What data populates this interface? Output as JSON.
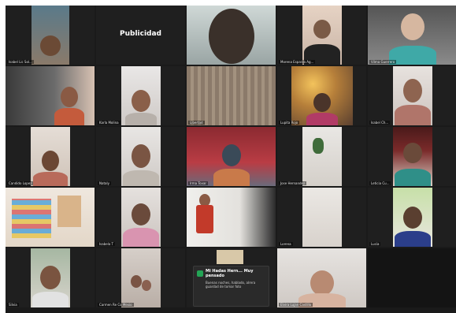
{
  "meeting": {
    "publicidad_label": "Publicidad",
    "notification": {
      "title": "Mi Hadas Hern... Muy pensado",
      "body": "Buenas noches, hablado, alrera guardad de tomar foto"
    },
    "participants": [
      {
        "name": "Isabel Lic Sol..."
      },
      {
        "name": ""
      },
      {
        "name": ""
      },
      {
        "name": "Morena Esparza Ag..."
      },
      {
        "name": "Vilma Guerrero"
      },
      {
        "name": ""
      },
      {
        "name": "Karla Molina"
      },
      {
        "name": "Libertad"
      },
      {
        "name": "Lupita Rojo"
      },
      {
        "name": "Isabel Ch..."
      },
      {
        "name": "Candido Lopez"
      },
      {
        "name": "Nataly"
      },
      {
        "name": "Irma Tovar"
      },
      {
        "name": "Jose Hernandez"
      },
      {
        "name": "Leticia Cu..."
      },
      {
        "name": ""
      },
      {
        "name": "Isabela T"
      },
      {
        "name": ""
      },
      {
        "name": "Lorena"
      },
      {
        "name": "Lucia"
      },
      {
        "name": "Silvia"
      },
      {
        "name": "Carmen Re Co Mexio"
      },
      {
        "name": ""
      },
      {
        "name": "Elvira Lujan Castillo"
      },
      {
        "name": ""
      }
    ]
  }
}
